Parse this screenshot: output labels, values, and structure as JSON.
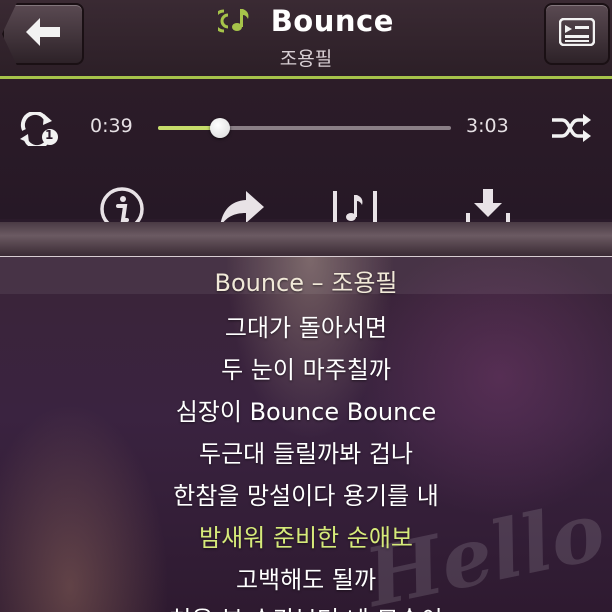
{
  "header": {
    "title": "Bounce",
    "artist": "조용필",
    "accent": "#a6c34a"
  },
  "player": {
    "current_time": "0:39",
    "total_time": "3:03",
    "progress_fraction": 0.213,
    "repeat_badge": "1"
  },
  "actions": [
    {
      "icon": "info-icon"
    },
    {
      "icon": "share-icon"
    },
    {
      "icon": "lyrics-icon"
    },
    {
      "icon": "download-icon"
    }
  ],
  "lyrics": {
    "lines": [
      "Bounce – 조용필",
      "그대가 돌아서면",
      "두 눈이 마주칠까",
      "심장이 Bounce Bounce",
      "두근대 들릴까봐 겁나",
      "한참을 망설이다 용기를 내",
      "밤새워 준비한 순애보",
      "고백해도 될까",
      "처음 본 순간부터 네 모습이"
    ],
    "active_index": 6,
    "active_color": "#d6ea7a"
  },
  "watermark": "Hello"
}
